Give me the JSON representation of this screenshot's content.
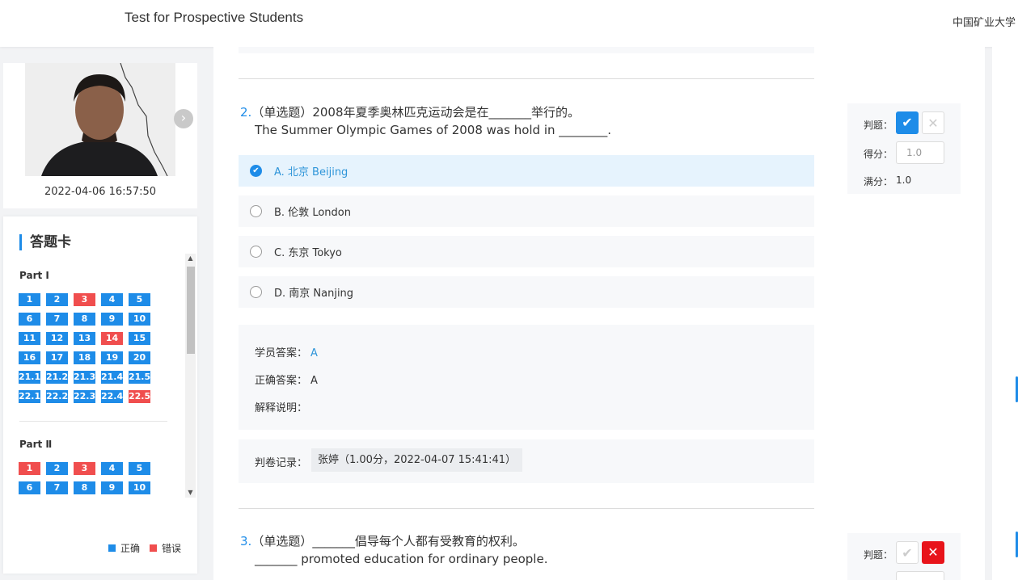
{
  "header": {
    "title": "Test for Prospective Students",
    "school": "中国矿业大学"
  },
  "camera": {
    "timestamp": "2022-04-06 16:57:50",
    "next_icon": "chevron-right-icon"
  },
  "answer_card": {
    "title": "答题卡",
    "parts": [
      {
        "label": "Part Ⅰ",
        "items": [
          {
            "n": "1",
            "status": "correct"
          },
          {
            "n": "2",
            "status": "correct"
          },
          {
            "n": "3",
            "status": "wrong"
          },
          {
            "n": "4",
            "status": "correct"
          },
          {
            "n": "5",
            "status": "correct"
          },
          {
            "n": "6",
            "status": "correct"
          },
          {
            "n": "7",
            "status": "correct"
          },
          {
            "n": "8",
            "status": "correct"
          },
          {
            "n": "9",
            "status": "correct"
          },
          {
            "n": "10",
            "status": "correct"
          },
          {
            "n": "11",
            "status": "correct"
          },
          {
            "n": "12",
            "status": "correct"
          },
          {
            "n": "13",
            "status": "correct"
          },
          {
            "n": "14",
            "status": "wrong"
          },
          {
            "n": "15",
            "status": "correct"
          },
          {
            "n": "16",
            "status": "correct"
          },
          {
            "n": "17",
            "status": "correct"
          },
          {
            "n": "18",
            "status": "correct"
          },
          {
            "n": "19",
            "status": "correct"
          },
          {
            "n": "20",
            "status": "correct"
          },
          {
            "n": "21.1",
            "status": "correct"
          },
          {
            "n": "21.2",
            "status": "correct"
          },
          {
            "n": "21.3",
            "status": "correct"
          },
          {
            "n": "21.4",
            "status": "correct"
          },
          {
            "n": "21.5",
            "status": "correct"
          },
          {
            "n": "22.1",
            "status": "correct"
          },
          {
            "n": "22.2",
            "status": "correct"
          },
          {
            "n": "22.3",
            "status": "correct"
          },
          {
            "n": "22.4",
            "status": "correct"
          },
          {
            "n": "22.5",
            "status": "wrong"
          }
        ]
      },
      {
        "label": "Part Ⅱ",
        "items": [
          {
            "n": "1",
            "status": "wrong"
          },
          {
            "n": "2",
            "status": "correct"
          },
          {
            "n": "3",
            "status": "wrong"
          },
          {
            "n": "4",
            "status": "correct"
          },
          {
            "n": "5",
            "status": "correct"
          },
          {
            "n": "6",
            "status": "correct"
          },
          {
            "n": "7",
            "status": "correct"
          },
          {
            "n": "8",
            "status": "correct"
          },
          {
            "n": "9",
            "status": "correct"
          },
          {
            "n": "10",
            "status": "correct"
          }
        ]
      }
    ],
    "legend": {
      "correct": "正确",
      "wrong": "错误"
    },
    "colors": {
      "correct": "#1e8ce8",
      "wrong": "#f04e4e"
    }
  },
  "questions": [
    {
      "number": "2.",
      "type": "（单选题）",
      "text_cn": "2008年夏季奥林匹克运动会是在_______举行的。",
      "text_en": "The Summer Olympic Games of 2008 was hold in ________.",
      "options": [
        {
          "label": "A.  北京 Beijing",
          "selected": true
        },
        {
          "label": "B.  伦敦 London",
          "selected": false
        },
        {
          "label": "C.  东京 Tokyo",
          "selected": false
        },
        {
          "label": "D.  南京 Nanjing",
          "selected": false
        }
      ],
      "student_answer_label": "学员答案：",
      "student_answer": "A",
      "correct_answer_label": "正确答案：",
      "correct_answer": "A",
      "explanation_label": "解释说明：",
      "record_label": "判卷记录：",
      "record_value": "张婷（1.00分，2022-04-07 15:41:41）",
      "judge_label": "判题：",
      "score_label": "得分：",
      "score_value": "1.0",
      "full_label": "满分：",
      "full_value": "1.0",
      "judged": "correct"
    },
    {
      "number": "3.",
      "type": "（单选题）",
      "text_cn": "_______倡导每个人都有受教育的权利。",
      "text_en": "_______ promoted education for ordinary people.",
      "judge_label": "判题：",
      "judged": "wrong"
    }
  ]
}
